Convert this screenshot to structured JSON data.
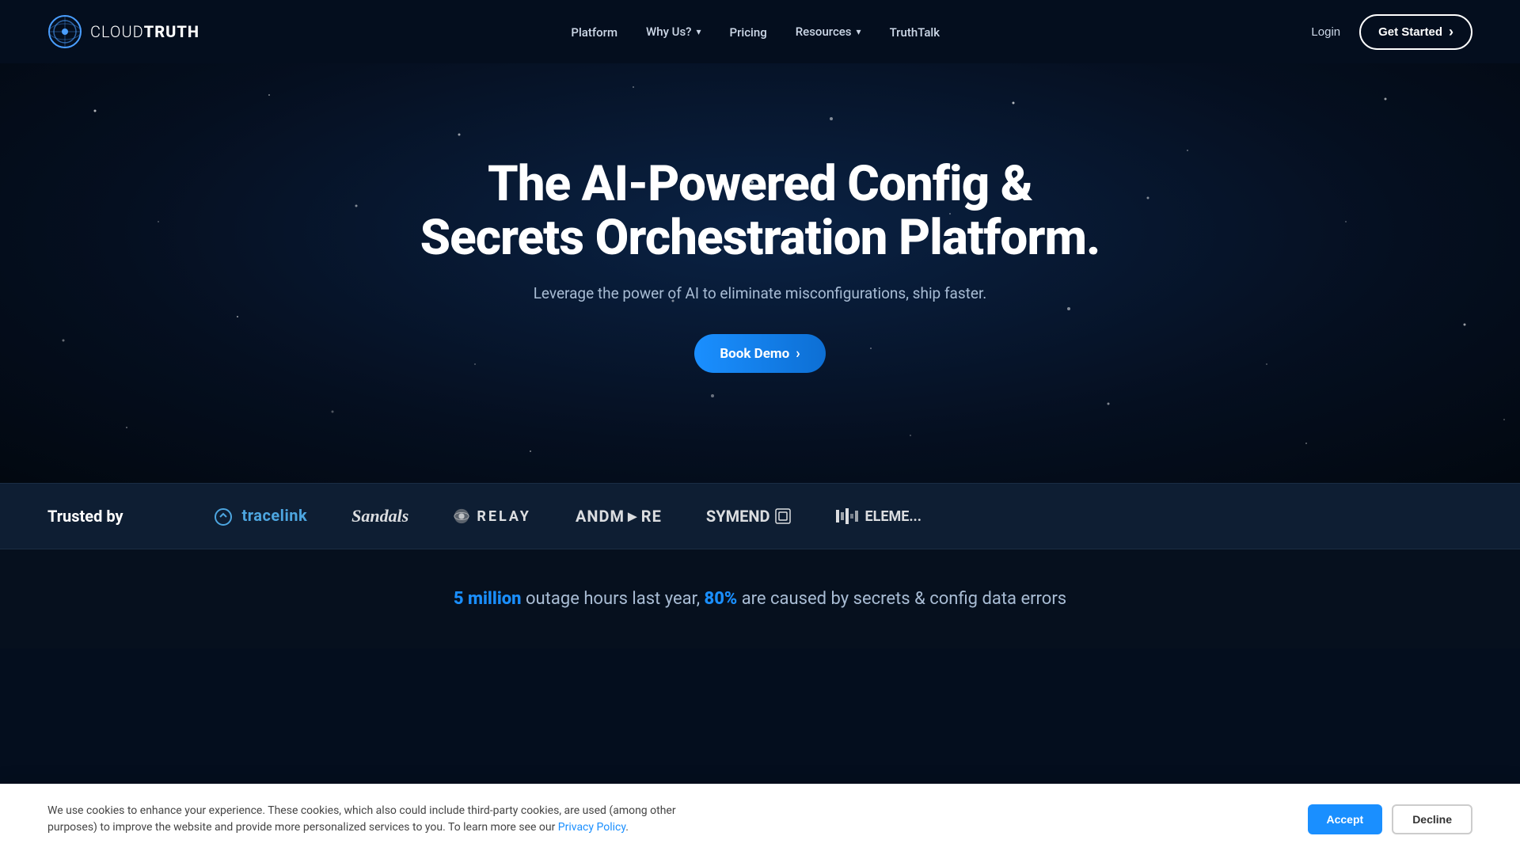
{
  "brand": {
    "name_part1": "CLOUD",
    "name_part2": "TRUTH"
  },
  "navbar": {
    "platform_label": "Platform",
    "why_us_label": "Why Us?",
    "pricing_label": "Pricing",
    "resources_label": "Resources",
    "truthtalk_label": "TruthTalk",
    "login_label": "Login",
    "get_started_label": "Get Started"
  },
  "hero": {
    "title": "The AI-Powered Config & Secrets Orchestration Platform.",
    "subtitle": "Leverage the power of AI to eliminate misconfigurations, ship faster.",
    "book_demo_label": "Book Demo"
  },
  "trusted": {
    "label": "Trusted by",
    "logos": [
      {
        "id": "tracelink",
        "name": "tracelink"
      },
      {
        "id": "sandals",
        "name": "Sandals"
      },
      {
        "id": "relay",
        "name": "RELAY"
      },
      {
        "id": "andmore",
        "name": "ANDMC► RE"
      },
      {
        "id": "symend",
        "name": "SYMEND"
      },
      {
        "id": "element",
        "name": "ELEMENT MACHI..."
      }
    ]
  },
  "stats": {
    "highlight1": "5 million",
    "text1": " outage hours last year, ",
    "highlight2": "80%",
    "text2": " are caused by secrets & config data errors"
  },
  "cookie": {
    "text": "We use cookies to enhance your experience. These cookies, which also could include third-party cookies, are used (among other purposes) to improve the website and provide more personalized services to you. To learn more see our ",
    "link_label": "Privacy Policy",
    "accept_label": "Accept",
    "decline_label": "Decline"
  }
}
